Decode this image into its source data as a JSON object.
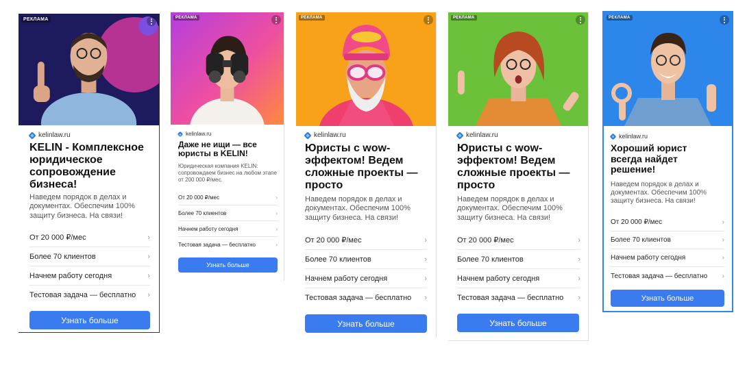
{
  "colors": {
    "accent": "#3b7bf0",
    "domain_icon": "#2a7ae4",
    "selected_border": "#2d86ea"
  },
  "cards": [
    {
      "badge": "РЕКЛАМА",
      "domain": "kelinlaw.ru",
      "title": "KELIN - Комплексное юридическое сопровождение бизнеса!",
      "description": "Наведем порядок в делах и документах. Обеспечим 100% защиту бизнеса. На связи!",
      "features": [
        "От 20 000 ₽/мес",
        "Более 70 клиентов",
        "Начнем работу сегодня",
        "Тестовая задача — бесплатно"
      ],
      "cta": "Узнать больше",
      "chevron": "›",
      "photo": "man-with-glasses-pointing-up"
    },
    {
      "badge": "РЕКЛАМА",
      "domain": "kelinlaw.ru",
      "title": "Даже не ищи — все юристы в KELIN!",
      "description": "Юридическая компания KELIN: сопровождаем бизнес на любом этапе от 200 000 ₽/мес.",
      "features": [
        "От 20 000 ₽/мес",
        "Более 70 клиентов",
        "Начнем работу сегодня",
        "Тестовая задача — бесплатно"
      ],
      "cta": "Узнать больше",
      "chevron": "›",
      "photo": "woman-with-binoculars"
    },
    {
      "badge": "РЕКЛАМА",
      "domain": "kelinlaw.ru",
      "title": "Юристы с wow-эффектом! Ведем сложные проекты — просто",
      "description": "Наведем порядок в делах и документах. Обеспечим 100% защиту бизнеса. На связи!",
      "features": [
        "От 20 000 ₽/мес",
        "Более 70 клиентов",
        "Начнем работу сегодня",
        "Тестовая задача — бесплатно"
      ],
      "cta": "Узнать больше",
      "chevron": "›",
      "photo": "bearded-man-in-pink-hat"
    },
    {
      "badge": "РЕКЛАМА",
      "domain": "kelinlaw.ru",
      "title": "Юристы с wow-эффектом! Ведем сложные проекты — просто",
      "description": "Наведем порядок в делах и документах. Обеспечим 100% защиту бизнеса. На связи!",
      "features": [
        "От 20 000 ₽/мес",
        "Более 70 клиентов",
        "Начнем работу сегодня",
        "Тестовая задача — бесплатно"
      ],
      "cta": "Узнать больше",
      "chevron": "›",
      "photo": "surprised-red-haired-woman"
    },
    {
      "badge": "РЕКЛАМА",
      "domain": "kelinlaw.ru",
      "title": "Хороший юрист всегда найдет решение!",
      "description": "Наведем порядок в делах и документах. Обеспечим 100% защиту бизнеса. На связи!",
      "features": [
        "От 20 000 ₽/мес",
        "Более 70 клиентов",
        "Начнем работу сегодня",
        "Тестовая задача — бесплатно"
      ],
      "cta": "Узнать больше",
      "chevron": "›",
      "photo": "smiling-man-ok-gesture"
    }
  ]
}
